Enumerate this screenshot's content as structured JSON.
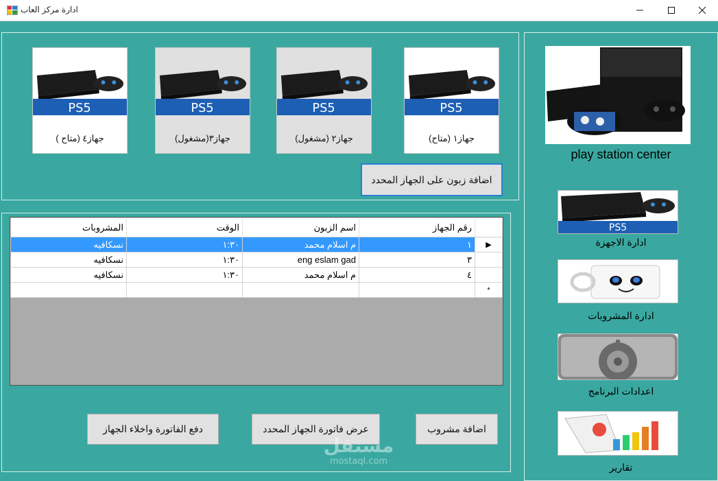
{
  "window": {
    "title": "ادارة مركز العاب"
  },
  "devices": [
    {
      "label": "جهاز١ (متاح)",
      "status": "available"
    },
    {
      "label": "جهاز٢ (مشغول)",
      "status": "busy"
    },
    {
      "label": "جهاز٣(مشغول)",
      "status": "busy"
    },
    {
      "label": "جهاز٤ (متاح )",
      "status": "available"
    }
  ],
  "console_logo_text": "PS5",
  "actions": {
    "add_customer": "اضافة زبون على الجهاز المحدد",
    "add_drink": "اضافة مشروب",
    "show_invoice": "عرض فاتورة الجهاز المحدد",
    "pay_invoice": "دفع الفاتورة واخلاء الجهاز"
  },
  "grid": {
    "columns": [
      "رقم الجهاز",
      "اسم الزبون",
      "الوقت",
      "المشروبات"
    ],
    "rows": [
      [
        "١",
        "م اسلام محمد",
        "١:٣٠",
        "نسكافيه"
      ],
      [
        "٣",
        "eng eslam gad",
        "١:٣٠",
        "نسكافيه"
      ],
      [
        "٤",
        "م اسلام محمد",
        "١:٣٠",
        "نسكافيه"
      ]
    ],
    "selected_row": 0,
    "current_marker": "▶",
    "new_row_marker": "*"
  },
  "sidebar": {
    "brand": "play station center",
    "items": [
      {
        "label": "ادارة الاجهزة",
        "icon": "console-icon"
      },
      {
        "label": "ادارة المشروبات",
        "icon": "mug-icon"
      },
      {
        "label": "اعدادات البرنامج",
        "icon": "gear-icon"
      },
      {
        "label": "تقارير",
        "icon": "report-chart-icon"
      }
    ]
  },
  "watermark": {
    "arabic": "مستقل",
    "latin": "mostaql.com"
  },
  "colors": {
    "background": "#3aa8a0",
    "selection": "#3399ff",
    "accent": "#2a7fd6"
  }
}
